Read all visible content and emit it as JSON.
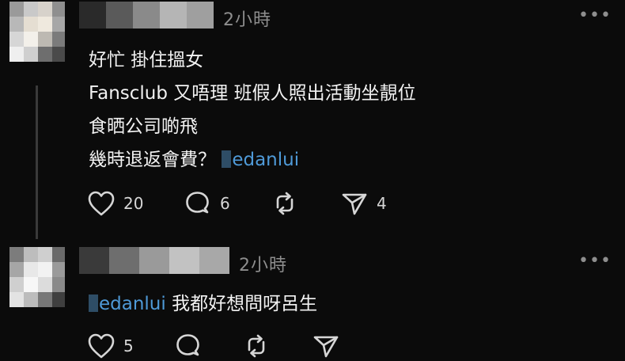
{
  "posts": [
    {
      "time": "2小時",
      "more": "•••",
      "lines": [
        {
          "text": "好忙 掛住搵女"
        },
        {
          "text": "Fansclub 又唔理 班假人照出活動坐靚位"
        },
        {
          "text": "食晒公司啲飛"
        },
        {
          "text": "幾時退返會費？",
          "mention": "edanlui"
        }
      ],
      "actions": {
        "like": "20",
        "comment": "6",
        "repost": "",
        "share": "4"
      }
    },
    {
      "time": "2小時",
      "more": "•••",
      "lines": [
        {
          "mention": "edanlui",
          "text": "我都好想問呀呂生"
        }
      ],
      "actions": {
        "like": "5",
        "comment": "",
        "repost": "",
        "share": ""
      }
    }
  ],
  "colors": {
    "background": "#0b0b0b",
    "text": "#f2f2f2",
    "muted": "#8e8e8e",
    "mention": "#4f9ad8"
  },
  "icons": {
    "like": "heart-icon",
    "comment": "comment-bubble-icon",
    "repost": "repost-icon",
    "share": "send-icon",
    "more": "more-dots-icon"
  }
}
